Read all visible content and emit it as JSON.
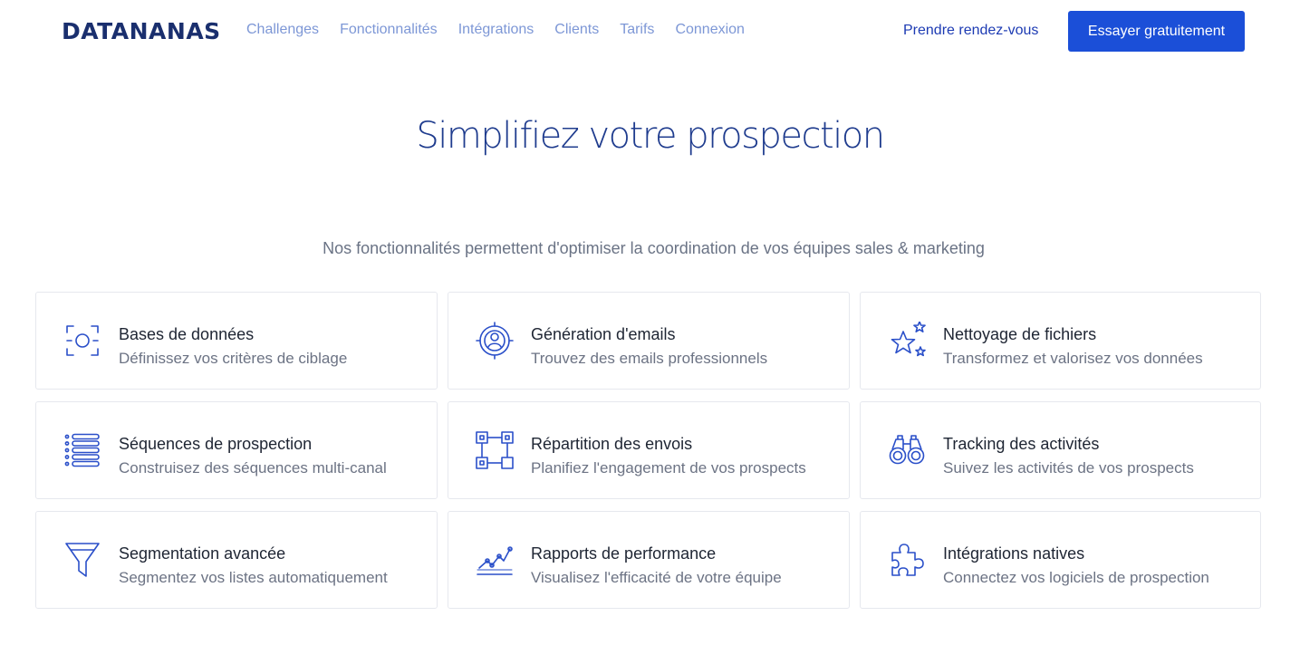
{
  "brand": {
    "logo_text": "DATANANAS"
  },
  "nav": {
    "links": [
      "Challenges",
      "Fonctionnalités",
      "Intégrations",
      "Clients",
      "Tarifs",
      "Connexion"
    ],
    "appointment_label": "Prendre rendez-vous",
    "cta_label": "Essayer gratuitement"
  },
  "hero": {
    "title": "Simplifiez votre prospection",
    "subtitle": "Nos fonctionnalités permettent d'optimiser la coordination de vos équipes sales & marketing"
  },
  "features": [
    {
      "icon": "database-target-icon",
      "title": "Bases de données",
      "desc": "Définissez vos critères de ciblage"
    },
    {
      "icon": "user-target-icon",
      "title": "Génération d'emails",
      "desc": "Trouvez des emails professionnels"
    },
    {
      "icon": "stars-icon",
      "title": "Nettoyage de fichiers",
      "desc": "Transformez et valorisez vos données"
    },
    {
      "icon": "list-icon",
      "title": "Séquences de prospection",
      "desc": "Construisez des séquences multi-canal"
    },
    {
      "icon": "distribution-icon",
      "title": "Répartition des envois",
      "desc": "Planifiez l'engagement de vos prospects"
    },
    {
      "icon": "binoculars-icon",
      "title": "Tracking des activités",
      "desc": "Suivez les activités de vos prospects"
    },
    {
      "icon": "funnel-icon",
      "title": "Segmentation avancée",
      "desc": "Segmentez vos listes automatiquement"
    },
    {
      "icon": "line-chart-icon",
      "title": "Rapports de performance",
      "desc": "Visualisez l'efficacité de votre équipe"
    },
    {
      "icon": "puzzle-icon",
      "title": "Intégrations natives",
      "desc": "Connectez vos logiciels de prospection"
    }
  ],
  "colors": {
    "brand_dark": "#1a2f6e",
    "accent": "#1b4fd8",
    "icon": "#2a4fc9",
    "nav_link": "#7d97d6"
  }
}
